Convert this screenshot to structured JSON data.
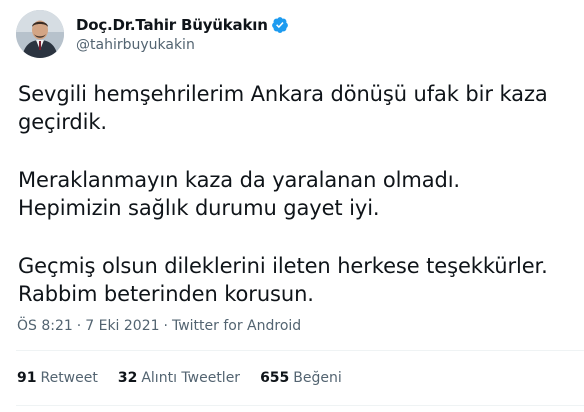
{
  "author": {
    "display_name": "Doç.Dr.Tahir Büyükakın",
    "handle": "@tahirbuyukakin",
    "verified_badge_color": "#1d9bf0"
  },
  "tweet": {
    "paragraphs": [
      "Sevgili hemşehrilerim Ankara dönüşü ufak bir kaza geçirdik.",
      "Meraklanmayın kaza da yaralanan olmadı. Hepimizin sağlık durumu gayet iyi.",
      "Geçmiş olsun dileklerini ileten herkese teşekkürler. Rabbim beterinden korusun."
    ],
    "time": "ÖS 8:21",
    "separator": "·",
    "date": "7 Eki 2021",
    "source": "Twitter for Android"
  },
  "stats": {
    "retweets": {
      "count": "91",
      "label": "Retweet"
    },
    "quotes": {
      "count": "32",
      "label": "Alıntı Tweetler"
    },
    "likes": {
      "count": "655",
      "label": "Beğeni"
    }
  },
  "colors": {
    "text_primary": "#0f1419",
    "text_secondary": "#536471",
    "divider": "#eff3f4"
  }
}
